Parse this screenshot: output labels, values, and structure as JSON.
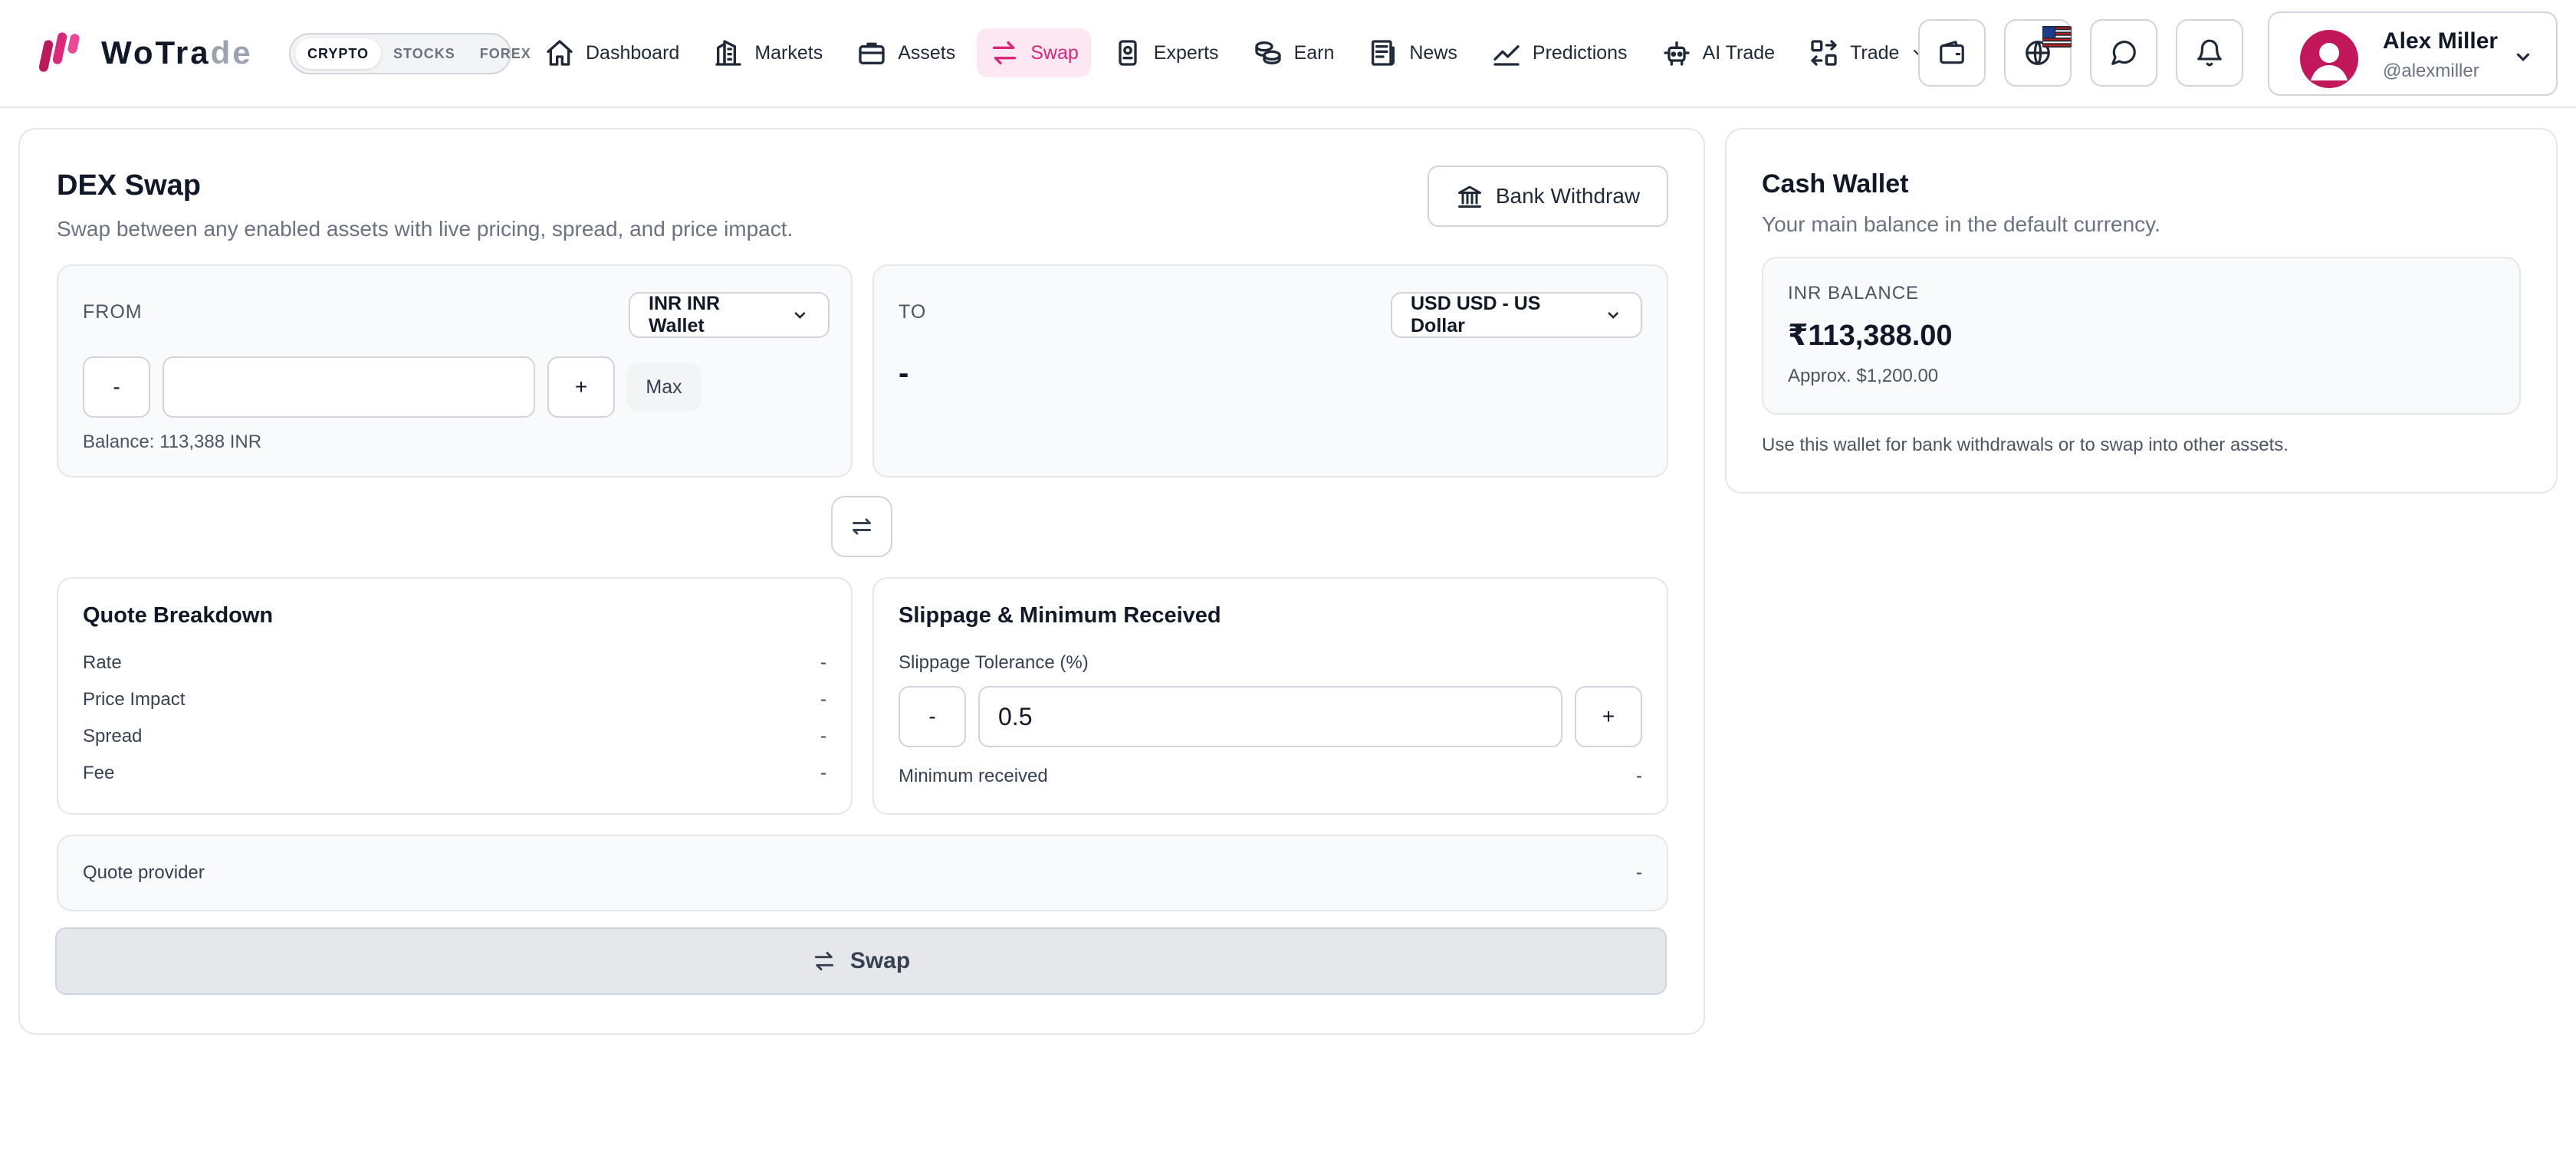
{
  "brand": {
    "name_main": "WoTra",
    "name_fade": "de"
  },
  "market_toggle": {
    "items": [
      "CRYPTO",
      "STOCKS",
      "FOREX"
    ],
    "active": "CRYPTO"
  },
  "nav": {
    "items": [
      {
        "label": "Dashboard",
        "icon": "home-icon"
      },
      {
        "label": "Markets",
        "icon": "building-icon"
      },
      {
        "label": "Assets",
        "icon": "briefcase-icon"
      },
      {
        "label": "Swap",
        "icon": "swap-icon",
        "active": true
      },
      {
        "label": "Experts",
        "icon": "badge-icon"
      },
      {
        "label": "Earn",
        "icon": "coins-icon"
      },
      {
        "label": "News",
        "icon": "newspaper-icon"
      },
      {
        "label": "Predictions",
        "icon": "trend-icon"
      },
      {
        "label": "AI Trade",
        "icon": "robot-icon"
      },
      {
        "label": "Trade",
        "icon": "arrows-icon",
        "dropdown": true
      }
    ]
  },
  "user": {
    "name": "Alex Miller",
    "handle": "@alexmiller"
  },
  "swap": {
    "title": "DEX Swap",
    "subtitle": "Swap between any enabled assets with live pricing, spread, and price impact.",
    "bank_withdraw_label": "Bank Withdraw",
    "from": {
      "label": "FROM",
      "asset": "INR INR Wallet",
      "minus": "-",
      "plus": "+",
      "max": "Max",
      "amount": "",
      "balance": "Balance: 113,388 INR"
    },
    "to": {
      "label": "TO",
      "asset": "USD USD - US Dollar",
      "amount": "-"
    },
    "quote": {
      "title": "Quote Breakdown",
      "rows": [
        {
          "label": "Rate",
          "value": "-"
        },
        {
          "label": "Price Impact",
          "value": "-"
        },
        {
          "label": "Spread",
          "value": "-"
        },
        {
          "label": "Fee",
          "value": "-"
        }
      ]
    },
    "slippage": {
      "title": "Slippage & Minimum Received",
      "tolerance_label": "Slippage Tolerance (%)",
      "minus": "-",
      "plus": "+",
      "value": "0.5",
      "min_received_label": "Minimum received",
      "min_received_value": "-"
    },
    "provider": {
      "label": "Quote provider",
      "value": "-"
    },
    "submit_label": "Swap"
  },
  "wallet": {
    "title": "Cash Wallet",
    "subtitle": "Your main balance in the default currency.",
    "balance_label": "INR BALANCE",
    "balance": "₹113,388.00",
    "approx": "Approx. $1,200.00",
    "note": "Use this wallet for bank withdrawals or to swap into other assets."
  },
  "colors": {
    "accent": "#db2777",
    "accent_bg": "#fce7f3",
    "panel": "#f9fafb",
    "border": "#e5e7eb"
  }
}
